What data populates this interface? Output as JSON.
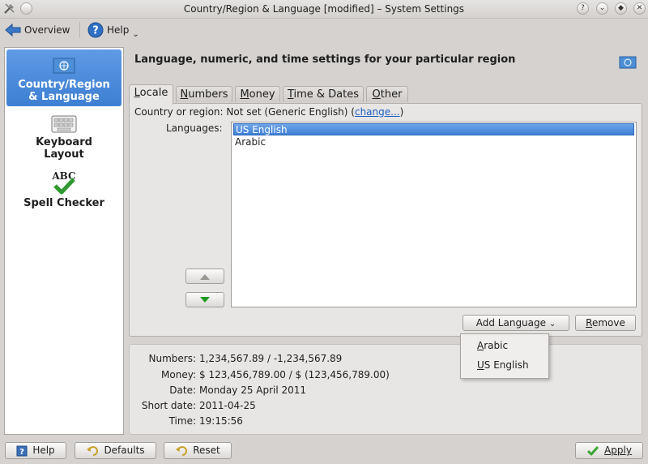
{
  "window": {
    "title": "Country/Region & Language [modified] – System Settings"
  },
  "toolbar": {
    "overview": "Overview",
    "help": "Help"
  },
  "sidebar": {
    "items": [
      {
        "label_line1": "Country/Region",
        "label_line2": "& Language",
        "icon": "un-flag-icon"
      },
      {
        "label_line1": "Keyboard",
        "label_line2": "Layout",
        "icon": "keyboard-icon"
      },
      {
        "label_line1": "Spell Checker",
        "label_line2": "",
        "icon": "spell-check-icon",
        "icon_text": "ABC"
      }
    ]
  },
  "header": {
    "title": "Language, numeric, and time settings for your particular region"
  },
  "tabs": [
    {
      "label": "Locale",
      "underline": "L",
      "rest": "ocale"
    },
    {
      "label": "Numbers",
      "underline": "N",
      "rest": "umbers"
    },
    {
      "label": "Money",
      "underline": "M",
      "rest": "oney"
    },
    {
      "label": "Time & Dates",
      "underline": "T",
      "rest": "ime & Dates"
    },
    {
      "label": "Other",
      "underline": "O",
      "rest": "ther"
    }
  ],
  "locale": {
    "country_label": "Country or region:",
    "country_value": "Not set (Generic English)",
    "change_link": "change...",
    "languages_label": "Languages:",
    "languages": [
      "US English",
      "Arabic"
    ],
    "selected_language": "US English"
  },
  "buttons": {
    "add_language": "Add Language",
    "remove_u": "R",
    "remove_rest": "emove",
    "help": "Help",
    "defaults": "Defaults",
    "reset": "Reset",
    "apply": "Apply"
  },
  "add_language_menu": {
    "items": [
      {
        "u": "A",
        "rest": "rabic"
      },
      {
        "u": "U",
        "rest": "S English"
      }
    ]
  },
  "summary": [
    {
      "key": "Numbers:",
      "value": "1,234,567.89 / -1,234,567.89"
    },
    {
      "key": "Money:",
      "value": "$ 123,456,789.00 / $ (123,456,789.00)"
    },
    {
      "key": "Date:",
      "value": "Monday 25 April 2011"
    },
    {
      "key": "Short date:",
      "value": "2011-04-25"
    },
    {
      "key": "Time:",
      "value": "19:15:56"
    }
  ],
  "colors": {
    "selection": "#3f80d4",
    "link": "#1b5fc4",
    "apply_check": "#3aa632"
  }
}
